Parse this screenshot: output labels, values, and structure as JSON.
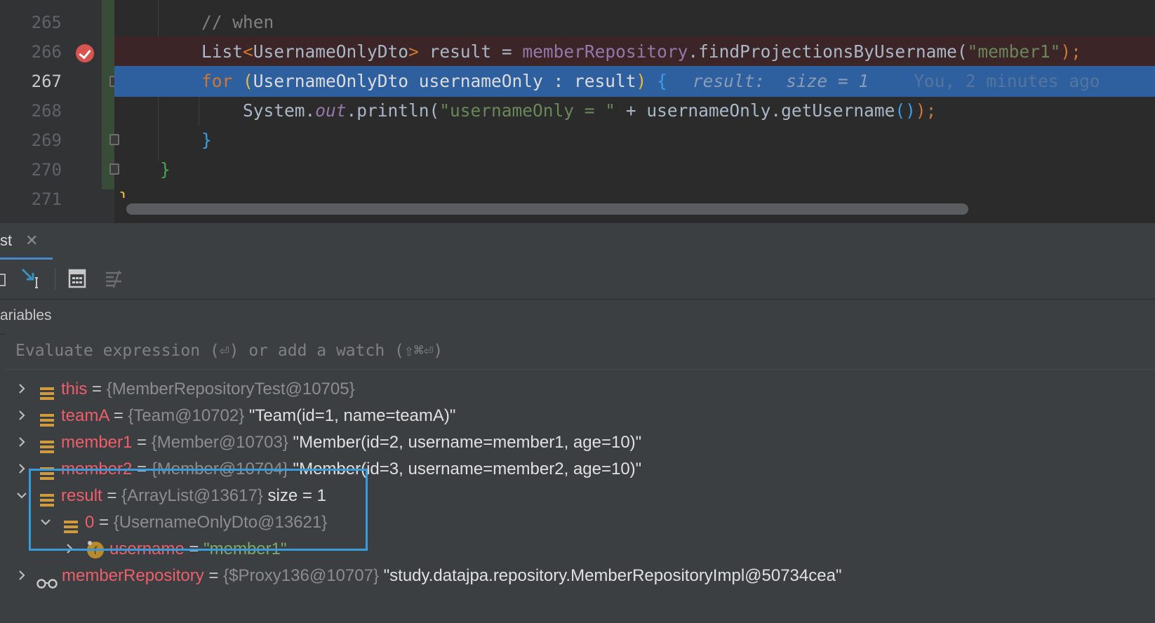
{
  "editor": {
    "line_numbers": [
      "265",
      "266",
      "267",
      "268",
      "269",
      "270",
      "271"
    ],
    "code_lines": {
      "l265": {
        "comment": "// when"
      },
      "l266": {
        "type": "List",
        "lt": "<",
        "generic": "UsernameOnlyDto",
        "gt": ">",
        "var": " result = ",
        "field": "memberRepository",
        "call": ".findProjectionsByUsername(",
        "arg": "\"member1\"",
        "end": ");"
      },
      "l267": {
        "kw": "for",
        "open": " (",
        "decl": "UsernameOnlyDto usernameOnly : result",
        "close": ")",
        "sp": " ",
        "brace": "{",
        "hint_label": "result:",
        "hint_value": "size = 1",
        "blame": "You, 2 minutes ago"
      },
      "l268": {
        "a": "System.",
        "b": "out",
        "c": ".println(",
        "str": "\"usernameOnly = \"",
        "d": " + usernameOnly.getUsername",
        "e": "()",
        "f": ");"
      },
      "l269": {
        "brace": "}"
      },
      "l270": {
        "brace": "}"
      },
      "l271": {
        "brace": "}"
      }
    }
  },
  "debug": {
    "tab_label": "st",
    "tab_close": "✕",
    "variables_header": "ariables",
    "eval_placeholder": "Evaluate expression (⏎) or add a watch (⇧⌘⏎)",
    "variables": [
      {
        "name": "this",
        "eq": " = ",
        "ref": "{MemberRepositoryTest@10705}",
        "val": "",
        "icon": "field-icon"
      },
      {
        "name": "teamA",
        "eq": " = ",
        "ref": "{Team@10702}",
        "val": " \"Team(id=1, name=teamA)\"",
        "icon": "field-icon"
      },
      {
        "name": "member1",
        "eq": " = ",
        "ref": "{Member@10703}",
        "val": " \"Member(id=2, username=member1, age=10)\"",
        "icon": "field-icon"
      },
      {
        "name": "member2",
        "eq": " = ",
        "ref": "{Member@10704}",
        "val": " \"Member(id=3, username=member2, age=10)\"",
        "icon": "field-icon"
      },
      {
        "name": "result",
        "eq": " = ",
        "ref": "{ArrayList@13617}",
        "val": "  size = 1",
        "icon": "field-icon"
      },
      {
        "name": "0",
        "eq": " = ",
        "ref": "{UsernameOnlyDto@13621}",
        "val": "",
        "icon": "field-icon"
      },
      {
        "name": "username",
        "eq": " = ",
        "ref": "",
        "val": "\"member1\"",
        "icon": "final-field-icon"
      },
      {
        "name": "memberRepository",
        "eq": " = ",
        "ref": "{$Proxy136@10707}",
        "val": " \"study.datajpa.repository.MemberRepositoryImpl@50734cea\"",
        "icon": "watch-glasses-icon"
      }
    ]
  },
  "colors": {
    "editor_bg": "#2b2b2b",
    "exec_line": "#2e5f9e",
    "breakpoint": "#d9534f",
    "highlight_box": "#3a9bd8"
  }
}
